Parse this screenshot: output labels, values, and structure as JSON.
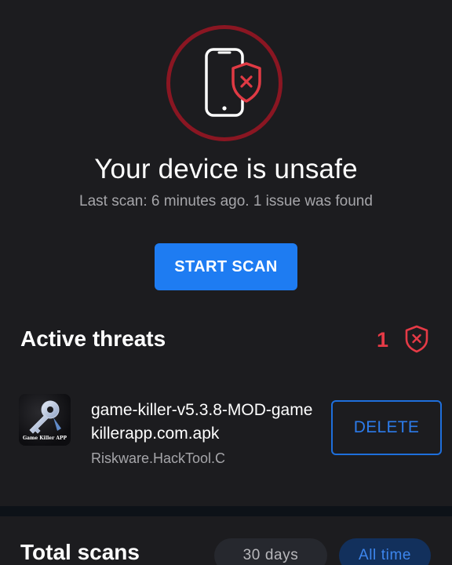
{
  "status": {
    "icon": "phone-shield-x-icon",
    "ring_color": "#8a1622",
    "title": "Your device is unsafe",
    "subtitle": "Last scan: 6 minutes ago. 1 issue was found"
  },
  "actions": {
    "start_scan_label": "START SCAN",
    "accent_color": "#1e7cf2"
  },
  "threats": {
    "title": "Active threats",
    "count": "1",
    "count_icon": "shield-x-icon",
    "danger_color": "#e53a46",
    "items": [
      {
        "app_icon": "game-killer-app-icon",
        "app_icon_caption": "Game Killer APP",
        "file_name": "game-killer-v5.3.8-MOD-gamekillerapp.com.apk",
        "threat_type": "Riskware.HackTool.C",
        "delete_label": "DELETE"
      }
    ]
  },
  "total_scans": {
    "title": "Total scans",
    "filters": [
      {
        "label": "30 days",
        "selected": false
      },
      {
        "label": "All time",
        "selected": true
      }
    ]
  }
}
